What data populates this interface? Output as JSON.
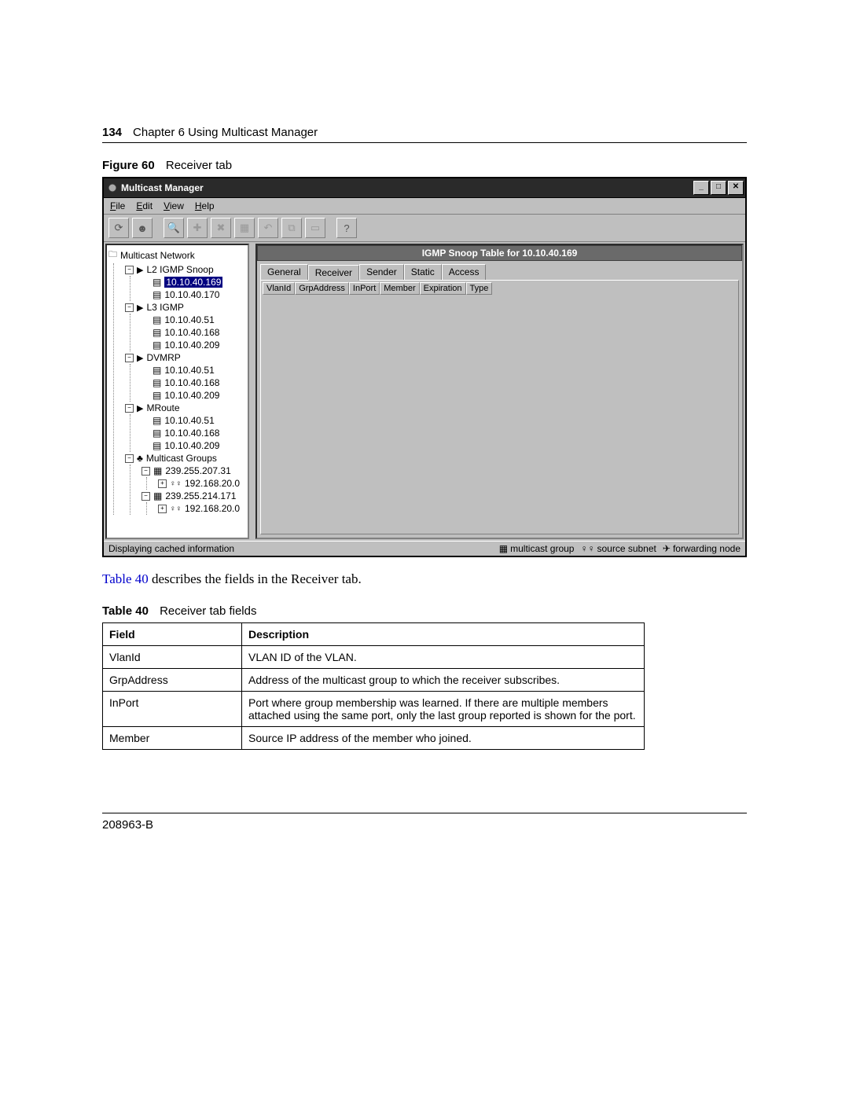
{
  "header": {
    "page_number": "134",
    "chapter": "Chapter 6  Using Multicast Manager"
  },
  "figure": {
    "label": "Figure 60",
    "title": "Receiver tab"
  },
  "app": {
    "title": "Multicast Manager",
    "window_buttons": {
      "min": "_",
      "max": "□",
      "close": "✕"
    },
    "menus": [
      "File",
      "Edit",
      "View",
      "Help"
    ],
    "toolbar_icons": [
      "refresh-icon",
      "alien-icon",
      "zoom-icon",
      "plus-icon",
      "delete-icon",
      "group-icon",
      "back-icon",
      "copy-icon",
      "file-icon",
      "help-icon"
    ],
    "tree": {
      "root": "Multicast Network",
      "groups": [
        {
          "name": "L2 IGMP Snoop",
          "expanded": true,
          "items": [
            "10.10.40.169",
            "10.10.40.170"
          ],
          "selected": "10.10.40.169"
        },
        {
          "name": "L3 IGMP",
          "expanded": true,
          "items": [
            "10.10.40.51",
            "10.10.40.168",
            "10.10.40.209"
          ]
        },
        {
          "name": "DVMRP",
          "expanded": true,
          "items": [
            "10.10.40.51",
            "10.10.40.168",
            "10.10.40.209"
          ]
        },
        {
          "name": "MRoute",
          "expanded": true,
          "items": [
            "10.10.40.51",
            "10.10.40.168",
            "10.10.40.209"
          ]
        },
        {
          "name": "Multicast Groups",
          "expanded": true,
          "type": "mgroup",
          "children": [
            {
              "ip": "239.255.207.31",
              "sub": [
                "192.168.20.0"
              ]
            },
            {
              "ip": "239.255.214.171",
              "sub": [
                "192.168.20.0"
              ]
            }
          ]
        }
      ]
    },
    "pane": {
      "title": "IGMP Snoop Table for 10.10.40.169",
      "tabs": [
        "General",
        "Receiver",
        "Sender",
        "Static",
        "Access"
      ],
      "active_tab": "Receiver",
      "columns": [
        "VlanId",
        "GrpAddress",
        "InPort",
        "Member",
        "Expiration",
        "Type"
      ]
    },
    "status": {
      "text": "Displaying cached information",
      "legend": [
        {
          "icon": "multicast-group-icon",
          "label": "multicast group"
        },
        {
          "icon": "source-subnet-icon",
          "label": "source subnet"
        },
        {
          "icon": "forwarding-node-icon",
          "label": "forwarding node"
        }
      ]
    }
  },
  "body": {
    "link_text": "Table 40",
    "after_link": " describes the fields in the Receiver tab."
  },
  "table_caption": {
    "label": "Table 40",
    "title": "Receiver tab fields"
  },
  "fields_table": {
    "headers": [
      "Field",
      "Description"
    ],
    "rows": [
      {
        "field": "VlanId",
        "desc": "VLAN ID of the VLAN."
      },
      {
        "field": "GrpAddress",
        "desc": "Address of the multicast group to which the receiver subscribes."
      },
      {
        "field": "InPort",
        "desc": "Port where group membership was learned. If there are multiple members attached using the same port, only the last group reported is shown for the port."
      },
      {
        "field": "Member",
        "desc": "Source IP address of the member who joined."
      }
    ]
  },
  "footer": {
    "doc_id": "208963-B"
  }
}
